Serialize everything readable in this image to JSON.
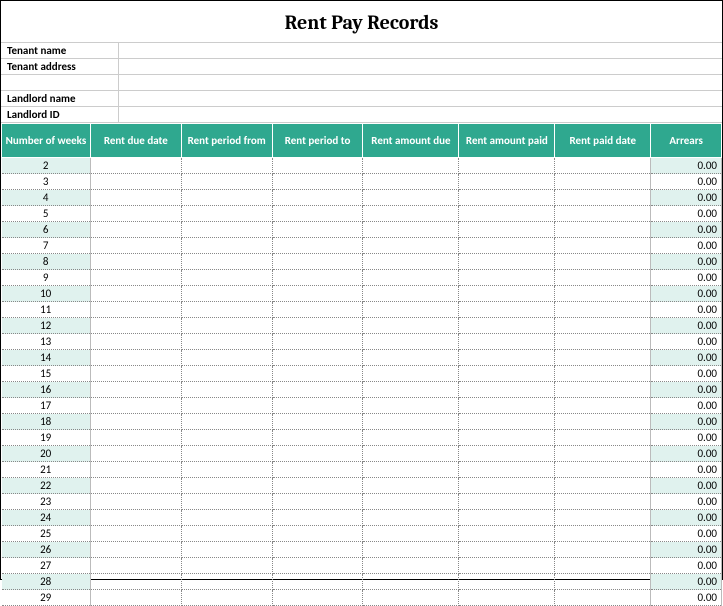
{
  "title": "Rent Pay Records",
  "meta": {
    "tenant_name_label": "Tenant name",
    "tenant_name_value": "",
    "tenant_address_label": "Tenant address",
    "tenant_address_value": "",
    "landlord_name_label": "Landlord name",
    "landlord_name_value": "",
    "landlord_id_label": "Landlord ID",
    "landlord_id_value": ""
  },
  "columns": {
    "weeks": "Number of weeks",
    "due_date": "Rent due date",
    "period_from": "Rent period from",
    "period_to": "Rent period to",
    "amount_due": "Rent amount due",
    "amount_paid": "Rent amount paid",
    "paid_date": "Rent paid date",
    "arrears": "Arrears"
  },
  "rows": [
    {
      "week": "2",
      "due_date": "",
      "period_from": "",
      "period_to": "",
      "amount_due": "",
      "amount_paid": "",
      "paid_date": "",
      "arrears": "0.00"
    },
    {
      "week": "3",
      "due_date": "",
      "period_from": "",
      "period_to": "",
      "amount_due": "",
      "amount_paid": "",
      "paid_date": "",
      "arrears": "0.00"
    },
    {
      "week": "4",
      "due_date": "",
      "period_from": "",
      "period_to": "",
      "amount_due": "",
      "amount_paid": "",
      "paid_date": "",
      "arrears": "0.00"
    },
    {
      "week": "5",
      "due_date": "",
      "period_from": "",
      "period_to": "",
      "amount_due": "",
      "amount_paid": "",
      "paid_date": "",
      "arrears": "0.00"
    },
    {
      "week": "6",
      "due_date": "",
      "period_from": "",
      "period_to": "",
      "amount_due": "",
      "amount_paid": "",
      "paid_date": "",
      "arrears": "0.00"
    },
    {
      "week": "7",
      "due_date": "",
      "period_from": "",
      "period_to": "",
      "amount_due": "",
      "amount_paid": "",
      "paid_date": "",
      "arrears": "0.00"
    },
    {
      "week": "8",
      "due_date": "",
      "period_from": "",
      "period_to": "",
      "amount_due": "",
      "amount_paid": "",
      "paid_date": "",
      "arrears": "0.00"
    },
    {
      "week": "9",
      "due_date": "",
      "period_from": "",
      "period_to": "",
      "amount_due": "",
      "amount_paid": "",
      "paid_date": "",
      "arrears": "0.00"
    },
    {
      "week": "10",
      "due_date": "",
      "period_from": "",
      "period_to": "",
      "amount_due": "",
      "amount_paid": "",
      "paid_date": "",
      "arrears": "0.00"
    },
    {
      "week": "11",
      "due_date": "",
      "period_from": "",
      "period_to": "",
      "amount_due": "",
      "amount_paid": "",
      "paid_date": "",
      "arrears": "0.00"
    },
    {
      "week": "12",
      "due_date": "",
      "period_from": "",
      "period_to": "",
      "amount_due": "",
      "amount_paid": "",
      "paid_date": "",
      "arrears": "0.00"
    },
    {
      "week": "13",
      "due_date": "",
      "period_from": "",
      "period_to": "",
      "amount_due": "",
      "amount_paid": "",
      "paid_date": "",
      "arrears": "0.00"
    },
    {
      "week": "14",
      "due_date": "",
      "period_from": "",
      "period_to": "",
      "amount_due": "",
      "amount_paid": "",
      "paid_date": "",
      "arrears": "0.00"
    },
    {
      "week": "15",
      "due_date": "",
      "period_from": "",
      "period_to": "",
      "amount_due": "",
      "amount_paid": "",
      "paid_date": "",
      "arrears": "0.00"
    },
    {
      "week": "16",
      "due_date": "",
      "period_from": "",
      "period_to": "",
      "amount_due": "",
      "amount_paid": "",
      "paid_date": "",
      "arrears": "0.00"
    },
    {
      "week": "17",
      "due_date": "",
      "period_from": "",
      "period_to": "",
      "amount_due": "",
      "amount_paid": "",
      "paid_date": "",
      "arrears": "0.00"
    },
    {
      "week": "18",
      "due_date": "",
      "period_from": "",
      "period_to": "",
      "amount_due": "",
      "amount_paid": "",
      "paid_date": "",
      "arrears": "0.00"
    },
    {
      "week": "19",
      "due_date": "",
      "period_from": "",
      "period_to": "",
      "amount_due": "",
      "amount_paid": "",
      "paid_date": "",
      "arrears": "0.00"
    },
    {
      "week": "20",
      "due_date": "",
      "period_from": "",
      "period_to": "",
      "amount_due": "",
      "amount_paid": "",
      "paid_date": "",
      "arrears": "0.00"
    },
    {
      "week": "21",
      "due_date": "",
      "period_from": "",
      "period_to": "",
      "amount_due": "",
      "amount_paid": "",
      "paid_date": "",
      "arrears": "0.00"
    },
    {
      "week": "22",
      "due_date": "",
      "period_from": "",
      "period_to": "",
      "amount_due": "",
      "amount_paid": "",
      "paid_date": "",
      "arrears": "0.00"
    },
    {
      "week": "23",
      "due_date": "",
      "period_from": "",
      "period_to": "",
      "amount_due": "",
      "amount_paid": "",
      "paid_date": "",
      "arrears": "0.00"
    },
    {
      "week": "24",
      "due_date": "",
      "period_from": "",
      "period_to": "",
      "amount_due": "",
      "amount_paid": "",
      "paid_date": "",
      "arrears": "0.00"
    },
    {
      "week": "25",
      "due_date": "",
      "period_from": "",
      "period_to": "",
      "amount_due": "",
      "amount_paid": "",
      "paid_date": "",
      "arrears": "0.00"
    },
    {
      "week": "26",
      "due_date": "",
      "period_from": "",
      "period_to": "",
      "amount_due": "",
      "amount_paid": "",
      "paid_date": "",
      "arrears": "0.00"
    },
    {
      "week": "27",
      "due_date": "",
      "period_from": "",
      "period_to": "",
      "amount_due": "",
      "amount_paid": "",
      "paid_date": "",
      "arrears": "0.00"
    },
    {
      "week": "28",
      "due_date": "",
      "period_from": "",
      "period_to": "",
      "amount_due": "",
      "amount_paid": "",
      "paid_date": "",
      "arrears": "0.00"
    },
    {
      "week": "29",
      "due_date": "",
      "period_from": "",
      "period_to": "",
      "amount_due": "",
      "amount_paid": "",
      "paid_date": "",
      "arrears": "0.00"
    }
  ]
}
